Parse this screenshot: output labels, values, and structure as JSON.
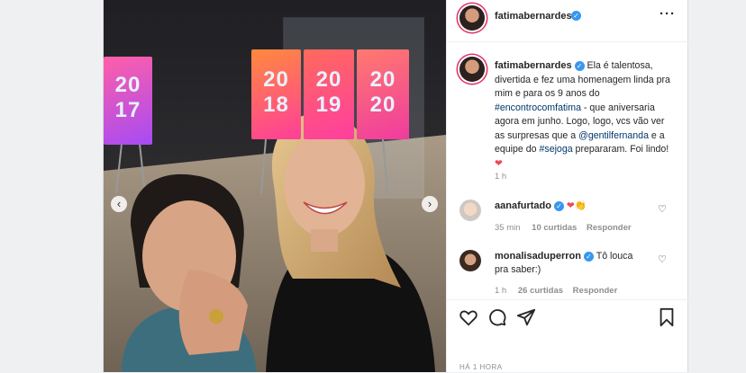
{
  "post": {
    "username": "fatimabernardes",
    "more_icon": "more-icon"
  },
  "photo": {
    "signs": [
      {
        "line1": "20",
        "line2": "17"
      },
      {
        "line1": "20",
        "line2": "18"
      },
      {
        "line1": "20",
        "line2": "19"
      },
      {
        "line1": "20",
        "line2": "20"
      }
    ],
    "prev": "‹",
    "next": "›"
  },
  "caption": {
    "username": "fatimabernardes",
    "text1": "Ela é talentosa, divertida e fez uma homenagem linda pra mim e para os 9 anos do",
    "hashtag1": "#encontrocomfatima",
    "text2": " - que aniversaria agora em junho. Logo, logo, vcs vão ver as surpresas que a",
    "mention": "@gentilfernanda",
    "text3": " e a equipe do",
    "hashtag2": "#sejoga",
    "text4": " prepararam. Foi lindo!",
    "emoji": "❤",
    "time": "1 h"
  },
  "comments": [
    {
      "username": "aanafurtado",
      "text": "❤👏",
      "time": "35 min",
      "likes": "10 curtidas",
      "reply": "Responder"
    },
    {
      "username": "monalisaduperron",
      "text": "Tô louca pra saber:)",
      "time": "1 h",
      "likes": "26 curtidas",
      "reply": "Responder"
    }
  ],
  "footer": {
    "timestamp": "HÁ 1 HORA"
  },
  "colors": {
    "verified": "#3897f0",
    "link": "#00376b",
    "heart": "#ed4956"
  }
}
